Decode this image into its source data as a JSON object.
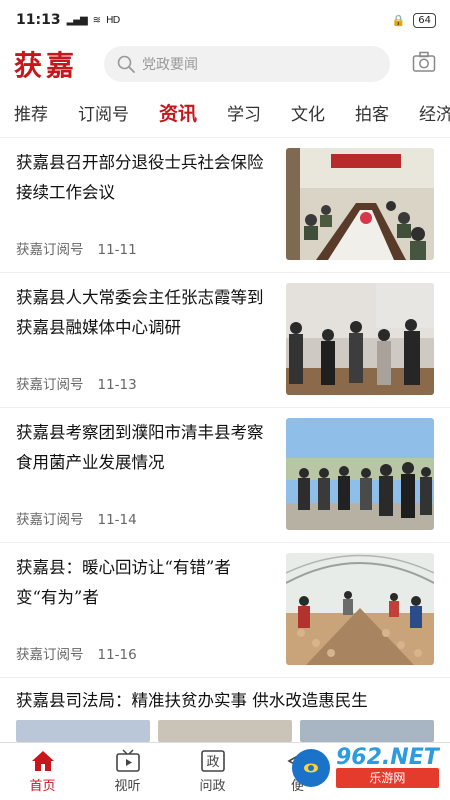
{
  "status": {
    "time": "11:13",
    "signal": "5G",
    "wifi": "HD",
    "battery": "64"
  },
  "header": {
    "logo": "获嘉",
    "search_placeholder": "党政要闻"
  },
  "tabs": [
    {
      "label": "推荐"
    },
    {
      "label": "订阅号"
    },
    {
      "label": "资讯"
    },
    {
      "label": "学习"
    },
    {
      "label": "文化"
    },
    {
      "label": "拍客"
    },
    {
      "label": "经济"
    }
  ],
  "active_tab": "资讯",
  "news": [
    {
      "title": "获嘉县召开部分退役士兵社会保险接续工作会议",
      "source": "获嘉订阅号",
      "date": "11-11",
      "thumb": "meeting-room"
    },
    {
      "title": "获嘉县人大常委会主任张志霞等到获嘉县融媒体中心调研",
      "source": "获嘉订阅号",
      "date": "11-13",
      "thumb": "group-indoor"
    },
    {
      "title": "获嘉县考察团到濮阳市清丰县考察食用菌产业发展情况",
      "source": "获嘉订阅号",
      "date": "11-14",
      "thumb": "group-outdoor"
    },
    {
      "title": "获嘉县：暖心回访让“有错”者变“有为”者",
      "source": "获嘉订阅号",
      "date": "11-16",
      "thumb": "greenhouse"
    },
    {
      "title": "获嘉县司法局：精准扶贫办实事 供水改造惠民生"
    }
  ],
  "bottom_nav": [
    {
      "label": "首页",
      "icon": "home-icon"
    },
    {
      "label": "视听",
      "icon": "tv-icon"
    },
    {
      "label": "问政",
      "icon": "zheng-icon"
    },
    {
      "label": "便",
      "icon": "service-icon"
    }
  ],
  "watermark": {
    "text": "962.NET",
    "sub": "乐游网"
  },
  "colors": {
    "brand": "#c8161d",
    "text": "#222222",
    "muted": "#666666"
  }
}
